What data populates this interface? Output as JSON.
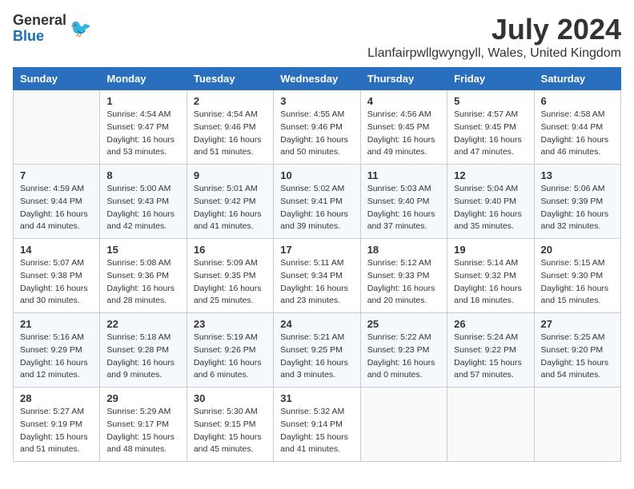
{
  "header": {
    "logo_general": "General",
    "logo_blue": "Blue",
    "month_title": "July 2024",
    "location": "Llanfairpwllgwyngyll, Wales, United Kingdom"
  },
  "weekdays": [
    "Sunday",
    "Monday",
    "Tuesday",
    "Wednesday",
    "Thursday",
    "Friday",
    "Saturday"
  ],
  "weeks": [
    [
      {
        "day": "",
        "sunrise": "",
        "sunset": "",
        "daylight": ""
      },
      {
        "day": "1",
        "sunrise": "Sunrise: 4:54 AM",
        "sunset": "Sunset: 9:47 PM",
        "daylight": "Daylight: 16 hours and 53 minutes."
      },
      {
        "day": "2",
        "sunrise": "Sunrise: 4:54 AM",
        "sunset": "Sunset: 9:46 PM",
        "daylight": "Daylight: 16 hours and 51 minutes."
      },
      {
        "day": "3",
        "sunrise": "Sunrise: 4:55 AM",
        "sunset": "Sunset: 9:46 PM",
        "daylight": "Daylight: 16 hours and 50 minutes."
      },
      {
        "day": "4",
        "sunrise": "Sunrise: 4:56 AM",
        "sunset": "Sunset: 9:45 PM",
        "daylight": "Daylight: 16 hours and 49 minutes."
      },
      {
        "day": "5",
        "sunrise": "Sunrise: 4:57 AM",
        "sunset": "Sunset: 9:45 PM",
        "daylight": "Daylight: 16 hours and 47 minutes."
      },
      {
        "day": "6",
        "sunrise": "Sunrise: 4:58 AM",
        "sunset": "Sunset: 9:44 PM",
        "daylight": "Daylight: 16 hours and 46 minutes."
      }
    ],
    [
      {
        "day": "7",
        "sunrise": "Sunrise: 4:59 AM",
        "sunset": "Sunset: 9:44 PM",
        "daylight": "Daylight: 16 hours and 44 minutes."
      },
      {
        "day": "8",
        "sunrise": "Sunrise: 5:00 AM",
        "sunset": "Sunset: 9:43 PM",
        "daylight": "Daylight: 16 hours and 42 minutes."
      },
      {
        "day": "9",
        "sunrise": "Sunrise: 5:01 AM",
        "sunset": "Sunset: 9:42 PM",
        "daylight": "Daylight: 16 hours and 41 minutes."
      },
      {
        "day": "10",
        "sunrise": "Sunrise: 5:02 AM",
        "sunset": "Sunset: 9:41 PM",
        "daylight": "Daylight: 16 hours and 39 minutes."
      },
      {
        "day": "11",
        "sunrise": "Sunrise: 5:03 AM",
        "sunset": "Sunset: 9:40 PM",
        "daylight": "Daylight: 16 hours and 37 minutes."
      },
      {
        "day": "12",
        "sunrise": "Sunrise: 5:04 AM",
        "sunset": "Sunset: 9:40 PM",
        "daylight": "Daylight: 16 hours and 35 minutes."
      },
      {
        "day": "13",
        "sunrise": "Sunrise: 5:06 AM",
        "sunset": "Sunset: 9:39 PM",
        "daylight": "Daylight: 16 hours and 32 minutes."
      }
    ],
    [
      {
        "day": "14",
        "sunrise": "Sunrise: 5:07 AM",
        "sunset": "Sunset: 9:38 PM",
        "daylight": "Daylight: 16 hours and 30 minutes."
      },
      {
        "day": "15",
        "sunrise": "Sunrise: 5:08 AM",
        "sunset": "Sunset: 9:36 PM",
        "daylight": "Daylight: 16 hours and 28 minutes."
      },
      {
        "day": "16",
        "sunrise": "Sunrise: 5:09 AM",
        "sunset": "Sunset: 9:35 PM",
        "daylight": "Daylight: 16 hours and 25 minutes."
      },
      {
        "day": "17",
        "sunrise": "Sunrise: 5:11 AM",
        "sunset": "Sunset: 9:34 PM",
        "daylight": "Daylight: 16 hours and 23 minutes."
      },
      {
        "day": "18",
        "sunrise": "Sunrise: 5:12 AM",
        "sunset": "Sunset: 9:33 PM",
        "daylight": "Daylight: 16 hours and 20 minutes."
      },
      {
        "day": "19",
        "sunrise": "Sunrise: 5:14 AM",
        "sunset": "Sunset: 9:32 PM",
        "daylight": "Daylight: 16 hours and 18 minutes."
      },
      {
        "day": "20",
        "sunrise": "Sunrise: 5:15 AM",
        "sunset": "Sunset: 9:30 PM",
        "daylight": "Daylight: 16 hours and 15 minutes."
      }
    ],
    [
      {
        "day": "21",
        "sunrise": "Sunrise: 5:16 AM",
        "sunset": "Sunset: 9:29 PM",
        "daylight": "Daylight: 16 hours and 12 minutes."
      },
      {
        "day": "22",
        "sunrise": "Sunrise: 5:18 AM",
        "sunset": "Sunset: 9:28 PM",
        "daylight": "Daylight: 16 hours and 9 minutes."
      },
      {
        "day": "23",
        "sunrise": "Sunrise: 5:19 AM",
        "sunset": "Sunset: 9:26 PM",
        "daylight": "Daylight: 16 hours and 6 minutes."
      },
      {
        "day": "24",
        "sunrise": "Sunrise: 5:21 AM",
        "sunset": "Sunset: 9:25 PM",
        "daylight": "Daylight: 16 hours and 3 minutes."
      },
      {
        "day": "25",
        "sunrise": "Sunrise: 5:22 AM",
        "sunset": "Sunset: 9:23 PM",
        "daylight": "Daylight: 16 hours and 0 minutes."
      },
      {
        "day": "26",
        "sunrise": "Sunrise: 5:24 AM",
        "sunset": "Sunset: 9:22 PM",
        "daylight": "Daylight: 15 hours and 57 minutes."
      },
      {
        "day": "27",
        "sunrise": "Sunrise: 5:25 AM",
        "sunset": "Sunset: 9:20 PM",
        "daylight": "Daylight: 15 hours and 54 minutes."
      }
    ],
    [
      {
        "day": "28",
        "sunrise": "Sunrise: 5:27 AM",
        "sunset": "Sunset: 9:19 PM",
        "daylight": "Daylight: 15 hours and 51 minutes."
      },
      {
        "day": "29",
        "sunrise": "Sunrise: 5:29 AM",
        "sunset": "Sunset: 9:17 PM",
        "daylight": "Daylight: 15 hours and 48 minutes."
      },
      {
        "day": "30",
        "sunrise": "Sunrise: 5:30 AM",
        "sunset": "Sunset: 9:15 PM",
        "daylight": "Daylight: 15 hours and 45 minutes."
      },
      {
        "day": "31",
        "sunrise": "Sunrise: 5:32 AM",
        "sunset": "Sunset: 9:14 PM",
        "daylight": "Daylight: 15 hours and 41 minutes."
      },
      {
        "day": "",
        "sunrise": "",
        "sunset": "",
        "daylight": ""
      },
      {
        "day": "",
        "sunrise": "",
        "sunset": "",
        "daylight": ""
      },
      {
        "day": "",
        "sunrise": "",
        "sunset": "",
        "daylight": ""
      }
    ]
  ]
}
